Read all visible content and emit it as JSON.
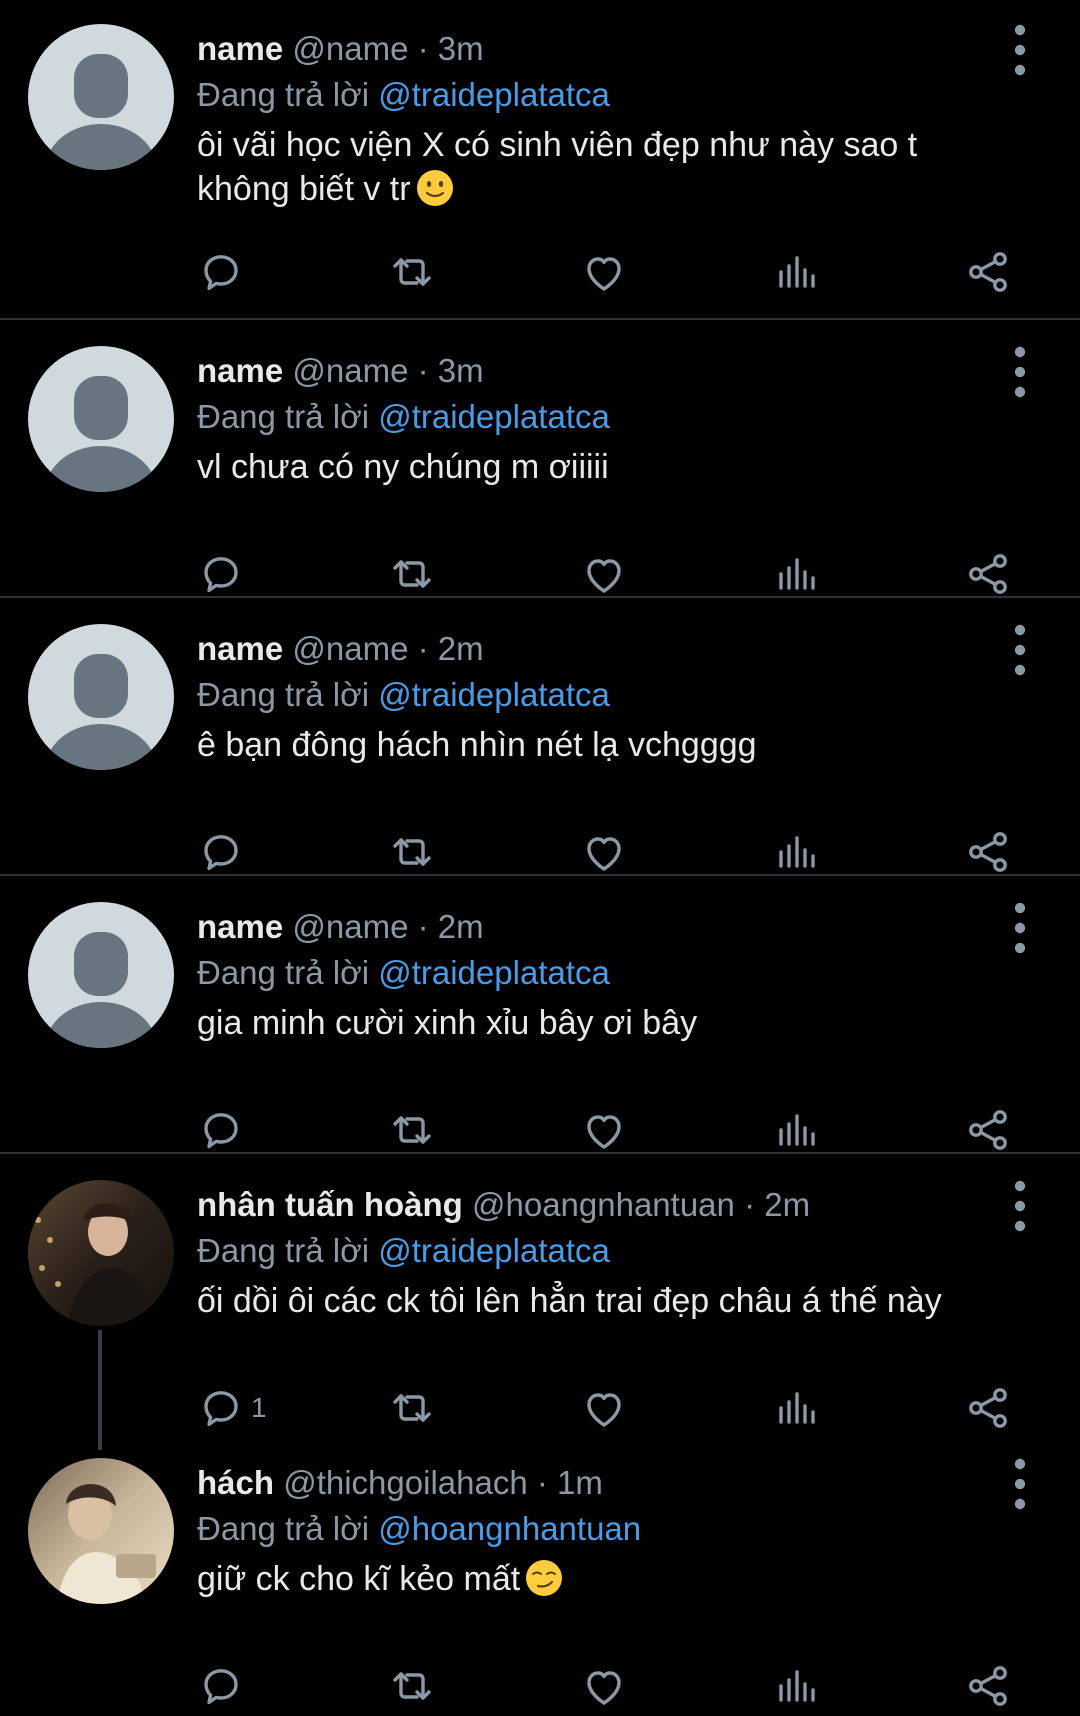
{
  "replying_label": "Đang trả lời",
  "colors": {
    "background": "#000000",
    "text": "#e7e9ea",
    "secondary": "#8b98a5",
    "mention": "#4a9ce9",
    "divider": "#2f3336"
  },
  "tweets": [
    {
      "name": "name",
      "handle": "@name",
      "separator": "·",
      "time": "3m",
      "reply_to": "@traideplatatca",
      "text_lines": [
        "ôi vãi học viện X có sinh viên đẹp như này sao t",
        "không biết v tr"
      ],
      "emoji": "slightly-smiling-face",
      "avatar": "default-avatar",
      "reply_count": ""
    },
    {
      "name": "name",
      "handle": "@name",
      "separator": "·",
      "time": "3m",
      "reply_to": "@traideplatatca",
      "text_lines": [
        "vl chưa có ny chúng m ơiiiii"
      ],
      "avatar": "default-avatar",
      "reply_count": ""
    },
    {
      "name": "name",
      "handle": "@name",
      "separator": "·",
      "time": "2m",
      "reply_to": "@traideplatatca",
      "text_lines": [
        "ê bạn đông hách nhìn nét lạ vchgggg"
      ],
      "avatar": "default-avatar",
      "reply_count": ""
    },
    {
      "name": "name",
      "handle": "@name",
      "separator": "·",
      "time": "2m",
      "reply_to": "@traideplatatca",
      "text_lines": [
        "gia minh cười xinh xỉu bây ơi bây"
      ],
      "avatar": "default-avatar",
      "reply_count": ""
    },
    {
      "name": "nhân tuấn hoàng",
      "handle": "@hoangnhantuan",
      "separator": "·",
      "time": "2m",
      "reply_to": "@traideplatatca",
      "text_lines": [
        "ối dồi ôi các ck tôi lên hẳn trai đẹp châu á thế này"
      ],
      "avatar": "photo-avatar",
      "reply_count": "1"
    },
    {
      "name": "hách",
      "handle": "@thichgoilahach",
      "separator": "·",
      "time": "1m",
      "reply_to": "@hoangnhantuan",
      "text_lines": [
        "giữ ck cho kĩ kẻo mất"
      ],
      "emoji": "smirking-face",
      "avatar": "photo-avatar",
      "reply_count": ""
    }
  ],
  "icons": {
    "reply": "reply-icon",
    "retweet": "retweet-icon",
    "like": "like-icon",
    "views": "views-icon",
    "share": "share-icon",
    "more": "more-options-icon"
  }
}
